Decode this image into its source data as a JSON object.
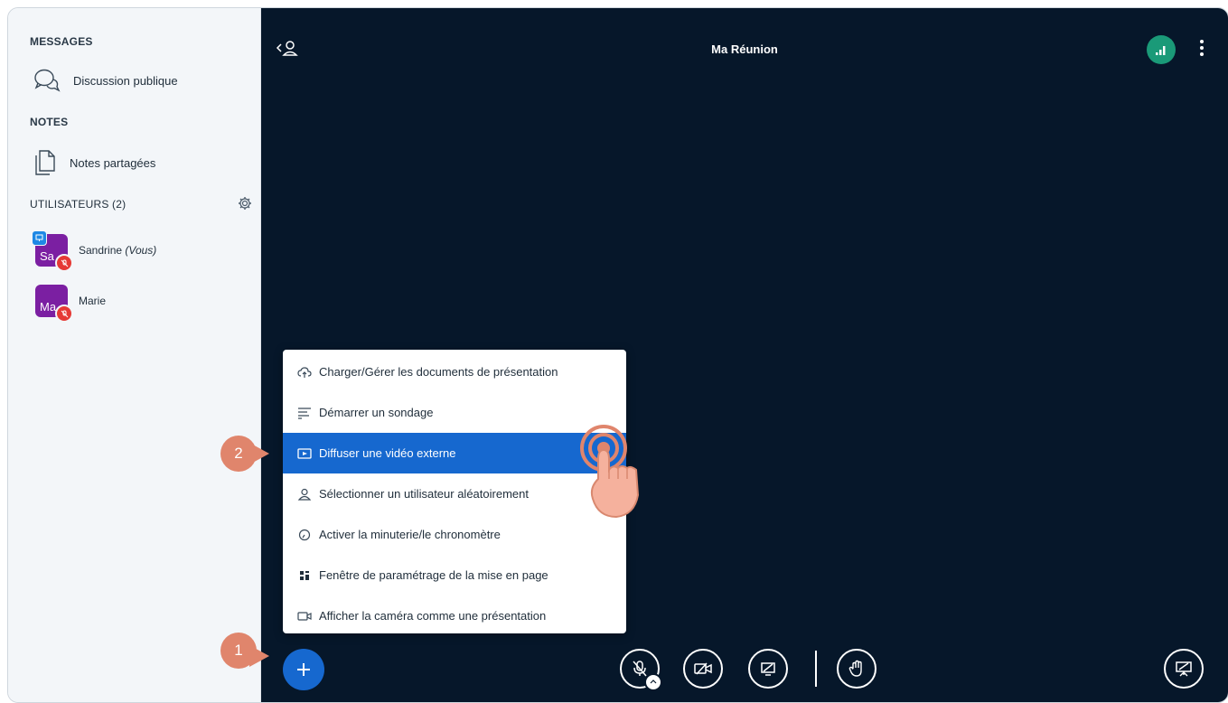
{
  "sidebar": {
    "messages_title": "MESSAGES",
    "public_chat_label": "Discussion publique",
    "notes_title": "NOTES",
    "shared_notes_label": "Notes partagées",
    "users_title": "UTILISATEURS (2)",
    "users": [
      {
        "initials": "Sa",
        "name": "Sandrine",
        "suffix": "(Vous)"
      },
      {
        "initials": "Ma",
        "name": "Marie",
        "suffix": ""
      }
    ]
  },
  "header": {
    "meeting_title": "Ma Réunion"
  },
  "actions_menu": {
    "items": [
      {
        "label": "Charger/Gérer les documents de présentation",
        "icon": "upload-cloud-icon"
      },
      {
        "label": "Démarrer un sondage",
        "icon": "poll-list-icon"
      },
      {
        "label": "Diffuser une vidéo externe",
        "icon": "external-video-icon",
        "active": true
      },
      {
        "label": "Sélectionner un utilisateur aléatoirement",
        "icon": "user-icon"
      },
      {
        "label": "Activer la minuterie/le chronomètre",
        "icon": "timer-icon"
      },
      {
        "label": "Fenêtre de paramétrage de la mise en page",
        "icon": "layout-grid-icon"
      },
      {
        "label": "Afficher la caméra comme une présentation",
        "icon": "camera-icon"
      }
    ]
  },
  "steps": {
    "step1": "1",
    "step2": "2"
  },
  "colors": {
    "main_bg": "#06172a",
    "accent_blue": "#1668cf",
    "avatar_purple": "#7b1fa2",
    "network_green": "#1a9a78",
    "step_badge": "#e0856c"
  }
}
